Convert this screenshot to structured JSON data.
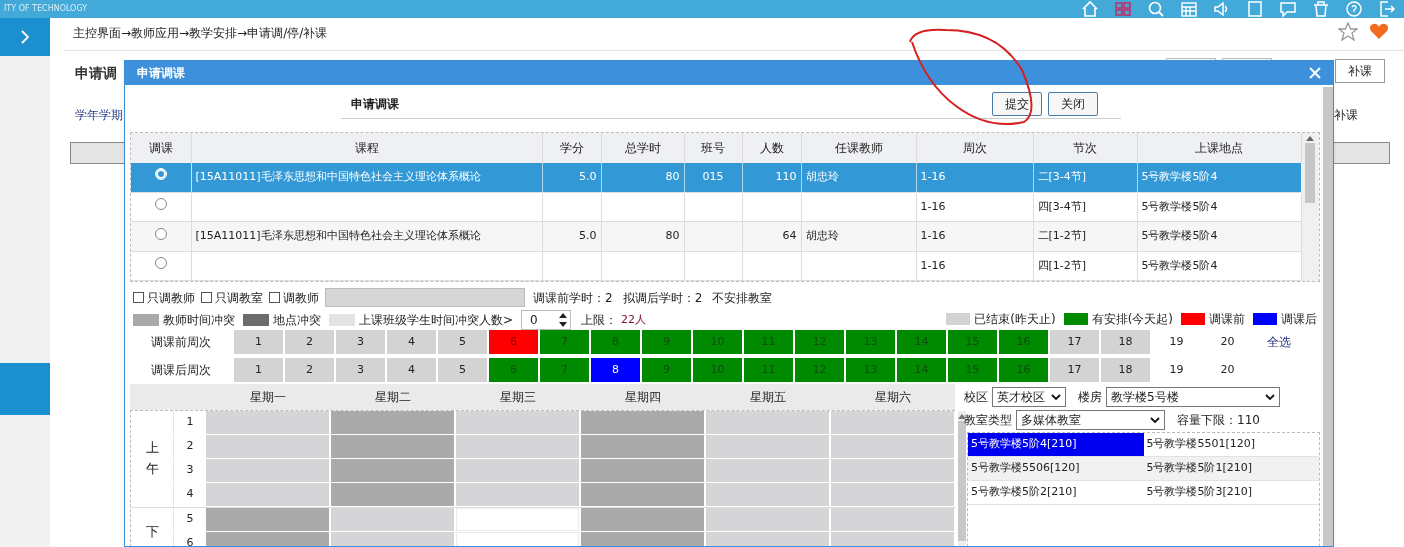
{
  "top_bar": {
    "brand_text": "ITY OF TECHNOLOGY"
  },
  "breadcrumb": "主控界面→教师应用→教学安排→申请调/停/补课",
  "page": {
    "title": "申请调",
    "filter_label": "学年学期",
    "toolbar_button": "补课",
    "row_button": "补课"
  },
  "dialog": {
    "title": "申请调课",
    "heading": "申请调课",
    "buttons": [
      "提交",
      "关闭"
    ]
  },
  "table": {
    "columns": [
      "调课",
      "课程",
      "学分",
      "总学时",
      "班号",
      "人数",
      "任课教师",
      "周次",
      "节次",
      "上课地点"
    ],
    "rows": [
      {
        "selected": true,
        "cells": [
          "",
          "[15A11011]毛泽东思想和中国特色社会主义理论体系概论",
          "5.0",
          "80",
          "015",
          "110",
          "胡忠玲",
          "1-16",
          "二[3-4节]",
          "5号教学楼5阶4"
        ]
      },
      {
        "selected": false,
        "cells": [
          "",
          "",
          "",
          "",
          "",
          "",
          "",
          "1-16",
          "四[3-4节]",
          "5号教学楼5阶4"
        ]
      },
      {
        "selected": false,
        "cells": [
          "",
          "[15A11011]毛泽东思想和中国特色社会主义理论体系概论",
          "5.0",
          "80",
          "",
          "64",
          "胡忠玲",
          "1-16",
          "二[1-2节]",
          "5号教学楼5阶4"
        ]
      },
      {
        "selected": false,
        "cells": [
          "",
          "",
          "",
          "",
          "",
          "",
          "",
          "1-16",
          "四[1-2节]",
          "5号教学楼5阶4"
        ]
      }
    ]
  },
  "options": [
    {
      "label": "只调教师",
      "checked": false
    },
    {
      "label": "只调教室",
      "checked": false
    },
    {
      "label": "调教师",
      "checked": false
    }
  ],
  "hours": [
    "调课前学时：2",
    "拟调后学时：2",
    "不安排教室"
  ],
  "conflict_legend": [
    {
      "label": "教师时间冲突",
      "color": "#a9a9a9"
    },
    {
      "label": "地点冲突",
      "color": "#6b6b6b"
    },
    {
      "label": "上课班级学生时间冲突人数>",
      "color": "#e3e3e3"
    }
  ],
  "conflict_count": "0",
  "limit_label": "上限：",
  "limit_value": "22人",
  "week_legend": [
    {
      "label": "已结束(昨天止)",
      "color": "#d3d3d3"
    },
    {
      "label": "有安排(今天起)",
      "color": "#008a00"
    },
    {
      "label": "调课前",
      "color": "#ff0000"
    },
    {
      "label": "调课后",
      "color": "#0000ff"
    }
  ],
  "week_rows": [
    {
      "label": "调课前周次",
      "select_all": "全选",
      "cells": [
        {
          "label": "1",
          "kind": "ended"
        },
        {
          "label": "2",
          "kind": "ended"
        },
        {
          "label": "3",
          "kind": "ended"
        },
        {
          "label": "4",
          "kind": "ended"
        },
        {
          "label": "5",
          "kind": "ended"
        },
        {
          "label": "6",
          "kind": "before"
        },
        {
          "label": "7",
          "kind": "scheduled"
        },
        {
          "label": "8",
          "kind": "scheduled"
        },
        {
          "label": "9",
          "kind": "scheduled"
        },
        {
          "label": "10",
          "kind": "scheduled"
        },
        {
          "label": "11",
          "kind": "scheduled"
        },
        {
          "label": "12",
          "kind": "scheduled"
        },
        {
          "label": "13",
          "kind": "scheduled"
        },
        {
          "label": "14",
          "kind": "scheduled"
        },
        {
          "label": "15",
          "kind": "scheduled"
        },
        {
          "label": "16",
          "kind": "scheduled"
        },
        {
          "label": "17",
          "kind": "ended"
        },
        {
          "label": "18",
          "kind": "ended"
        },
        {
          "label": "19",
          "kind": "free"
        },
        {
          "label": "20",
          "kind": "free"
        }
      ]
    },
    {
      "label": "调课后周次",
      "cells": [
        {
          "label": "1",
          "kind": "ended"
        },
        {
          "label": "2",
          "kind": "ended"
        },
        {
          "label": "3",
          "kind": "ended"
        },
        {
          "label": "4",
          "kind": "ended"
        },
        {
          "label": "5",
          "kind": "ended"
        },
        {
          "label": "6",
          "kind": "scheduled"
        },
        {
          "label": "7",
          "kind": "scheduled"
        },
        {
          "label": "8",
          "kind": "after"
        },
        {
          "label": "9",
          "kind": "scheduled"
        },
        {
          "label": "10",
          "kind": "scheduled"
        },
        {
          "label": "11",
          "kind": "scheduled"
        },
        {
          "label": "12",
          "kind": "scheduled"
        },
        {
          "label": "13",
          "kind": "scheduled"
        },
        {
          "label": "14",
          "kind": "scheduled"
        },
        {
          "label": "15",
          "kind": "scheduled"
        },
        {
          "label": "16",
          "kind": "scheduled"
        },
        {
          "label": "17",
          "kind": "ended"
        },
        {
          "label": "18",
          "kind": "ended"
        },
        {
          "label": "19",
          "kind": "free"
        },
        {
          "label": "20",
          "kind": "free"
        }
      ]
    }
  ],
  "schedule": {
    "days": [
      "星期一",
      "星期二",
      "星期三",
      "星期四",
      "星期五",
      "星期六"
    ],
    "groups": [
      {
        "label": "上午",
        "periods": [
          {
            "label": "1",
            "slots": [
              {
                "kind": "light"
              },
              {
                "kind": "dark"
              },
              {
                "kind": "light"
              },
              {
                "kind": "dark"
              },
              {
                "kind": "light"
              },
              {
                "kind": "light"
              }
            ]
          },
          {
            "label": "2",
            "slots": [
              {
                "kind": "light"
              },
              {
                "kind": "dark"
              },
              {
                "kind": "light"
              },
              {
                "kind": "dark"
              },
              {
                "kind": "light"
              },
              {
                "kind": "light"
              }
            ]
          },
          {
            "label": "3",
            "slots": [
              {
                "kind": "light"
              },
              {
                "kind": "dark"
              },
              {
                "kind": "light"
              },
              {
                "kind": "dark"
              },
              {
                "kind": "light"
              },
              {
                "kind": "light"
              }
            ]
          },
          {
            "label": "4",
            "slots": [
              {
                "kind": "light"
              },
              {
                "kind": "dark"
              },
              {
                "kind": "light"
              },
              {
                "kind": "dark"
              },
              {
                "kind": "light"
              },
              {
                "kind": "light"
              }
            ]
          }
        ]
      },
      {
        "label": "下",
        "periods": [
          {
            "label": "5",
            "slots": [
              {
                "kind": "dark"
              },
              {
                "kind": "light"
              },
              {
                "kind": "free"
              },
              {
                "kind": "dark"
              },
              {
                "kind": "light"
              },
              {
                "kind": "light"
              }
            ]
          },
          {
            "label": "6",
            "slots": [
              {
                "kind": "dark"
              },
              {
                "kind": "light"
              },
              {
                "kind": "free"
              },
              {
                "kind": "dark"
              },
              {
                "kind": "light"
              },
              {
                "kind": "light"
              }
            ]
          }
        ]
      }
    ]
  },
  "room_filters": {
    "campus_label": "校区",
    "campus": "英才校区",
    "building_label": "楼房",
    "building": "教学楼5号楼",
    "type_label": "教室类型",
    "type": "多媒体教室",
    "capacity": "容量下限：110"
  },
  "rooms": [
    {
      "name": "5号教学楼5阶4[210]",
      "selected": true
    },
    {
      "name": "5号教学楼5501[120]",
      "selected": false
    },
    {
      "name": "5号教学楼5506[120]",
      "selected": false
    },
    {
      "name": "5号教学楼5阶1[210]",
      "selected": false
    },
    {
      "name": "5号教学楼5阶2[210]",
      "selected": false
    },
    {
      "name": "5号教学楼5阶3[210]",
      "selected": false
    }
  ]
}
